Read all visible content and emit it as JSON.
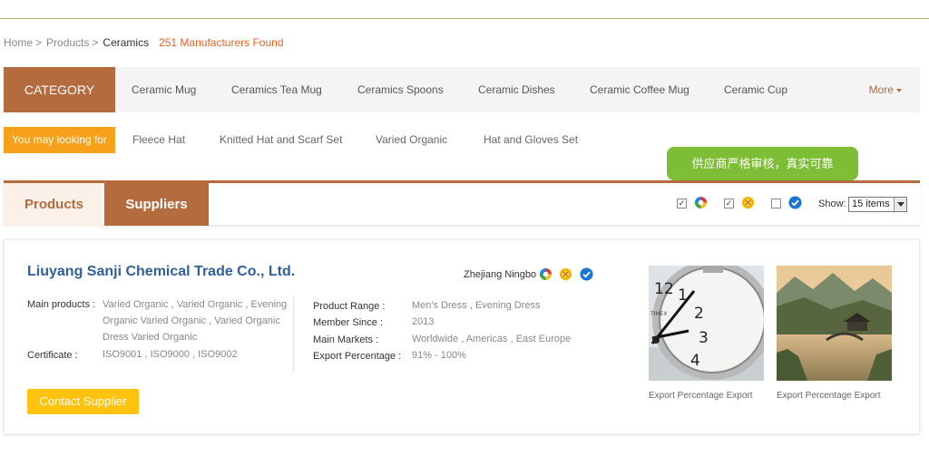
{
  "breadcrumb": {
    "home": "Home",
    "products": "Products",
    "current": "Ceramics",
    "found": "251 Manufacturers Found"
  },
  "category": {
    "label": "CATEGORY",
    "items": [
      "Ceramic Mug",
      "Ceramics Tea Mug",
      "Ceramics Spoons",
      "Ceramic Dishes",
      "Ceramic Coffee Mug",
      "Ceramic Cup"
    ],
    "more": "More"
  },
  "looking": {
    "label": "You may looking for",
    "items": [
      "Fleece Hat",
      "Knitted Hat and Scarf Set",
      "Varied Organic",
      "Hat and Gloves Set"
    ]
  },
  "tooltip": "供应商严格审核，真实可靠",
  "tabs": {
    "products": "Products",
    "suppliers": "Suppliers"
  },
  "filters": {
    "checks": [
      true,
      true,
      false
    ],
    "icons": [
      "rainbow-badge-icon",
      "gold-medal-icon",
      "verified-check-icon"
    ],
    "show_label": "Show:",
    "show_value": "15 items"
  },
  "supplier": {
    "name": "Liuyang Sanji Chemical Trade Co., Ltd.",
    "location": "Zhejiang Ningbo",
    "main_products_label": "Main products :",
    "main_products": "Varied Organic , Varied Organic , Evening Organic Varied Organic , Varied Organic Dress Varied Organic",
    "certificate_label": "Certificate :",
    "certificate": "ISO9001 , ISO9000 , ISO9002",
    "product_range_label": "Product Range :",
    "product_range": "Men's Dress , Evening Dress",
    "member_since_label": "Member Since :",
    "member_since": "2013",
    "main_markets_label": "Main Markets :",
    "main_markets": "Worldwide , Americas , East Europe",
    "export_label": "Export Percentage :",
    "export": "91% - 100%",
    "contact": "Contact Supplier",
    "photos": [
      {
        "caption": "Export Percentage Export",
        "image": "alarm-clock"
      },
      {
        "caption": "Export Percentage Export",
        "image": "river-town-bridge"
      }
    ]
  },
  "colors": {
    "brand_brown": "#b46c3e",
    "orange": "#f7a01a",
    "yellow_button": "#ffc20e",
    "tooltip_green": "#7dbe36",
    "company_blue": "#2f5f9c",
    "found_orange": "#e8621f"
  }
}
